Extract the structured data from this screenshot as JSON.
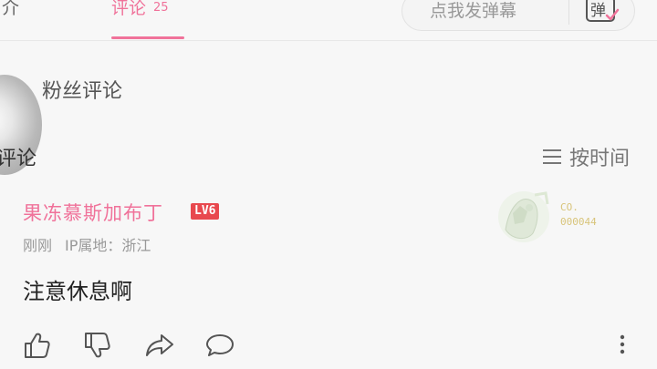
{
  "tabs": {
    "intro_label": "介",
    "comments_label": "评论",
    "comments_count": "25"
  },
  "danmaku": {
    "placeholder": "点我发弹幕",
    "button_label": "弹"
  },
  "fan_section": {
    "title": "粉丝评论"
  },
  "comments_section": {
    "title": "评论",
    "sort_label": "按时间"
  },
  "comment": {
    "username": "果冻慕斯加布丁",
    "level": "LV6",
    "time": "刚刚",
    "ip_location": "IP属地：浙江",
    "text": "注意休息啊",
    "decoration_code_line1": "CO.",
    "decoration_code_line2": "000044"
  },
  "colors": {
    "accent": "#f0729a",
    "level_badge": "#e8484e"
  },
  "icons": [
    "thumbs-up-icon",
    "thumbs-down-icon",
    "share-icon",
    "reply-icon",
    "more-icon",
    "menu-lines-icon",
    "danmaku-icon"
  ]
}
